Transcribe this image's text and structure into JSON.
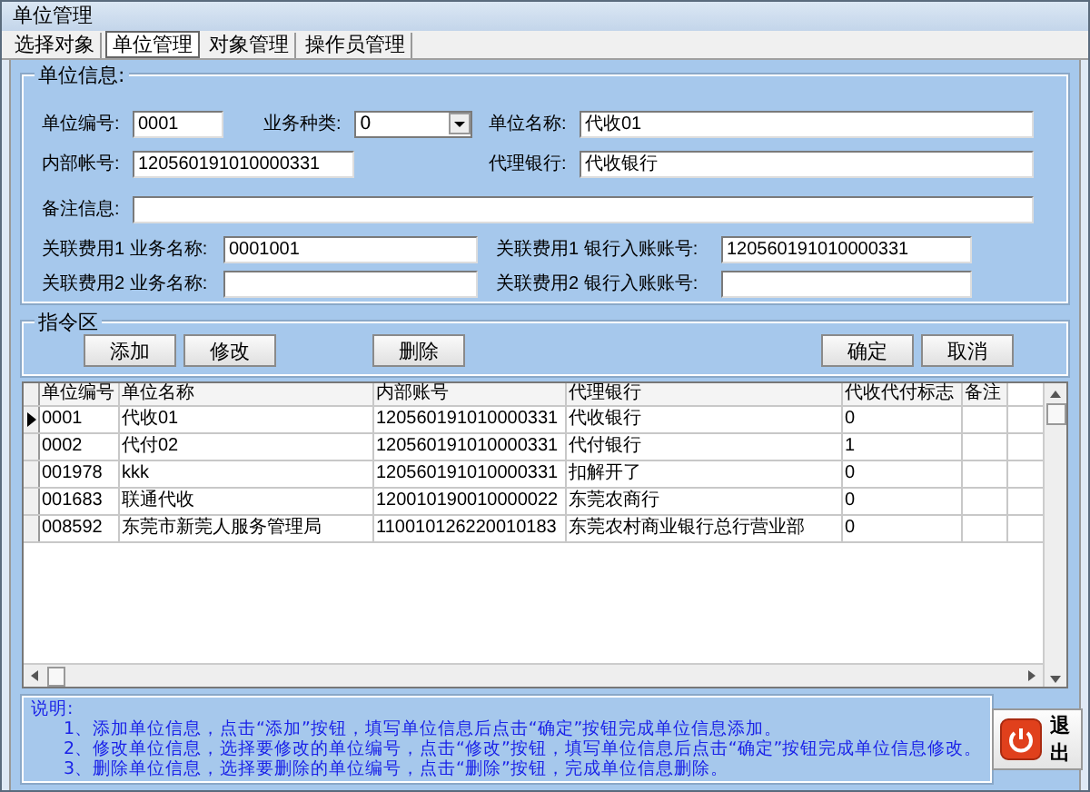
{
  "window": {
    "title": "单位管理"
  },
  "tabs": [
    {
      "label": "选择对象",
      "selected": false
    },
    {
      "label": "单位管理",
      "selected": true
    },
    {
      "label": "对象管理",
      "selected": false
    },
    {
      "label": "操作员管理",
      "selected": false
    }
  ],
  "unit_info": {
    "title": "单位信息:",
    "unit_code": {
      "label": "单位编号:",
      "value": "0001"
    },
    "business_type": {
      "label": "业务种类:",
      "value": "0"
    },
    "unit_name": {
      "label": "单位名称:",
      "value": "代收01"
    },
    "internal_account": {
      "label": "内部帐号:",
      "value": "120560191010000331"
    },
    "agent_bank": {
      "label": "代理银行:",
      "value": "代收银行"
    },
    "remarks": {
      "label": "备注信息:"
    },
    "fee_links": [
      {
        "label": "关联费用1 业务名称:",
        "business_name": "0001001",
        "account_label": "关联费用1 银行入账账号:",
        "account": "120560191010000331"
      },
      {
        "label": "关联费用2 业务名称:",
        "account_label": "关联费用2 银行入账账号:"
      }
    ]
  },
  "commands": {
    "title": "指令区",
    "buttons": [
      {
        "label": "添加"
      },
      {
        "label": "修改"
      },
      {
        "label": "删除"
      },
      {
        "label": "确定"
      },
      {
        "label": "取消"
      }
    ]
  },
  "table": {
    "columns": [
      "单位编号",
      "单位名称",
      "内部账号",
      "代理银行",
      "代收代付标志",
      "备注"
    ],
    "rows": [
      {
        "current": true,
        "cells": [
          "0001",
          "代收01",
          "120560191010000331",
          "代收银行",
          "0",
          ""
        ]
      },
      {
        "current": false,
        "cells": [
          "0002",
          "代付02",
          "120560191010000331",
          "代付银行",
          "1",
          ""
        ]
      },
      {
        "current": false,
        "cells": [
          "001978",
          "kkk",
          "120560191010000331",
          "扣解开了",
          "0",
          ""
        ]
      },
      {
        "current": false,
        "cells": [
          "001683",
          "联通代收",
          "120010190010000022",
          "东莞农商行",
          "0",
          ""
        ]
      },
      {
        "current": false,
        "cells": [
          "008592",
          "东莞市新莞人服务管理局",
          "110010126220010183",
          "东莞农村商业银行总行营业部",
          "0",
          ""
        ]
      }
    ]
  },
  "help": {
    "title": "说明:",
    "lines": [
      "1、添加单位信息，点击“添加”按钮，填写单位信息后点击“确定”按钮完成单位信息添加。",
      "2、修改单位信息，选择要修改的单位编号，点击“修改”按钮，填写单位信息后点击“确定”按钮完成单位信息修改。",
      "3、删除单位信息，选择要删除的单位编号，点击“删除”按钮，完成单位信息删除。"
    ]
  },
  "exit_button": {
    "label": "退出"
  }
}
